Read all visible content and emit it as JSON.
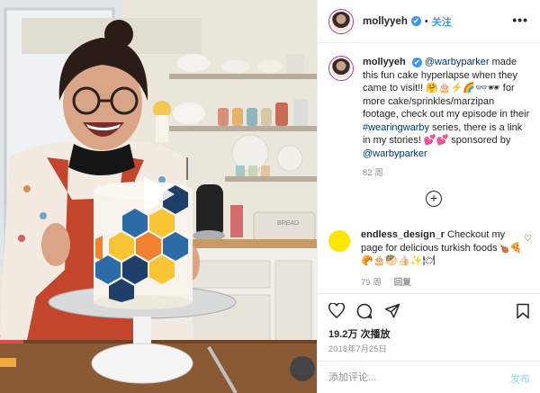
{
  "header": {
    "username": "mollyyeh",
    "verified_mark": "✔",
    "separator": "•",
    "follow_label": "关注",
    "more_label": "•••"
  },
  "caption": {
    "username": "mollyyeh",
    "mention1": "@warbyparker",
    "text1": " made this fun cake hyperlapse when they came to visit!! 🤗🎂⚡🌈👓🕶 for more cake/sprinkles/marzipan footage, check out my episode in their ",
    "hashtag": "#wearingwarby",
    "text2": " series, there is a link in my stories! 💕💕 sponsored by ",
    "mention2": "@warbyparker",
    "time": "82 周"
  },
  "load_more_label": "+",
  "comment": {
    "username": "endless_design_r",
    "text": " Checkout my page for delicious turkish foods🍗🍕🥐🎂🥙👍🏻✨🍽",
    "time": "79 周",
    "reply_label": "回复",
    "heart": "♡"
  },
  "stats": {
    "views": "19.2万 次播放",
    "date": "2018年7月25日"
  },
  "comment_box": {
    "placeholder": "添加评论...",
    "post_label": "发布"
  },
  "colors": {
    "link": "#00376b",
    "accent_blue": "#3897f0",
    "post_disabled": "#b2dffc",
    "comment_avatar": "#ffe600",
    "tile_blue": "#2d6ba6",
    "tile_navy": "#1f3f6b",
    "tile_orange": "#f0812f",
    "tile_yellow": "#f7c534",
    "tile_teal": "#5aa5c9"
  },
  "icons": [
    "heart-icon",
    "comment-icon",
    "share-icon",
    "bookmark-icon",
    "play-icon",
    "add-circle-icon"
  ]
}
